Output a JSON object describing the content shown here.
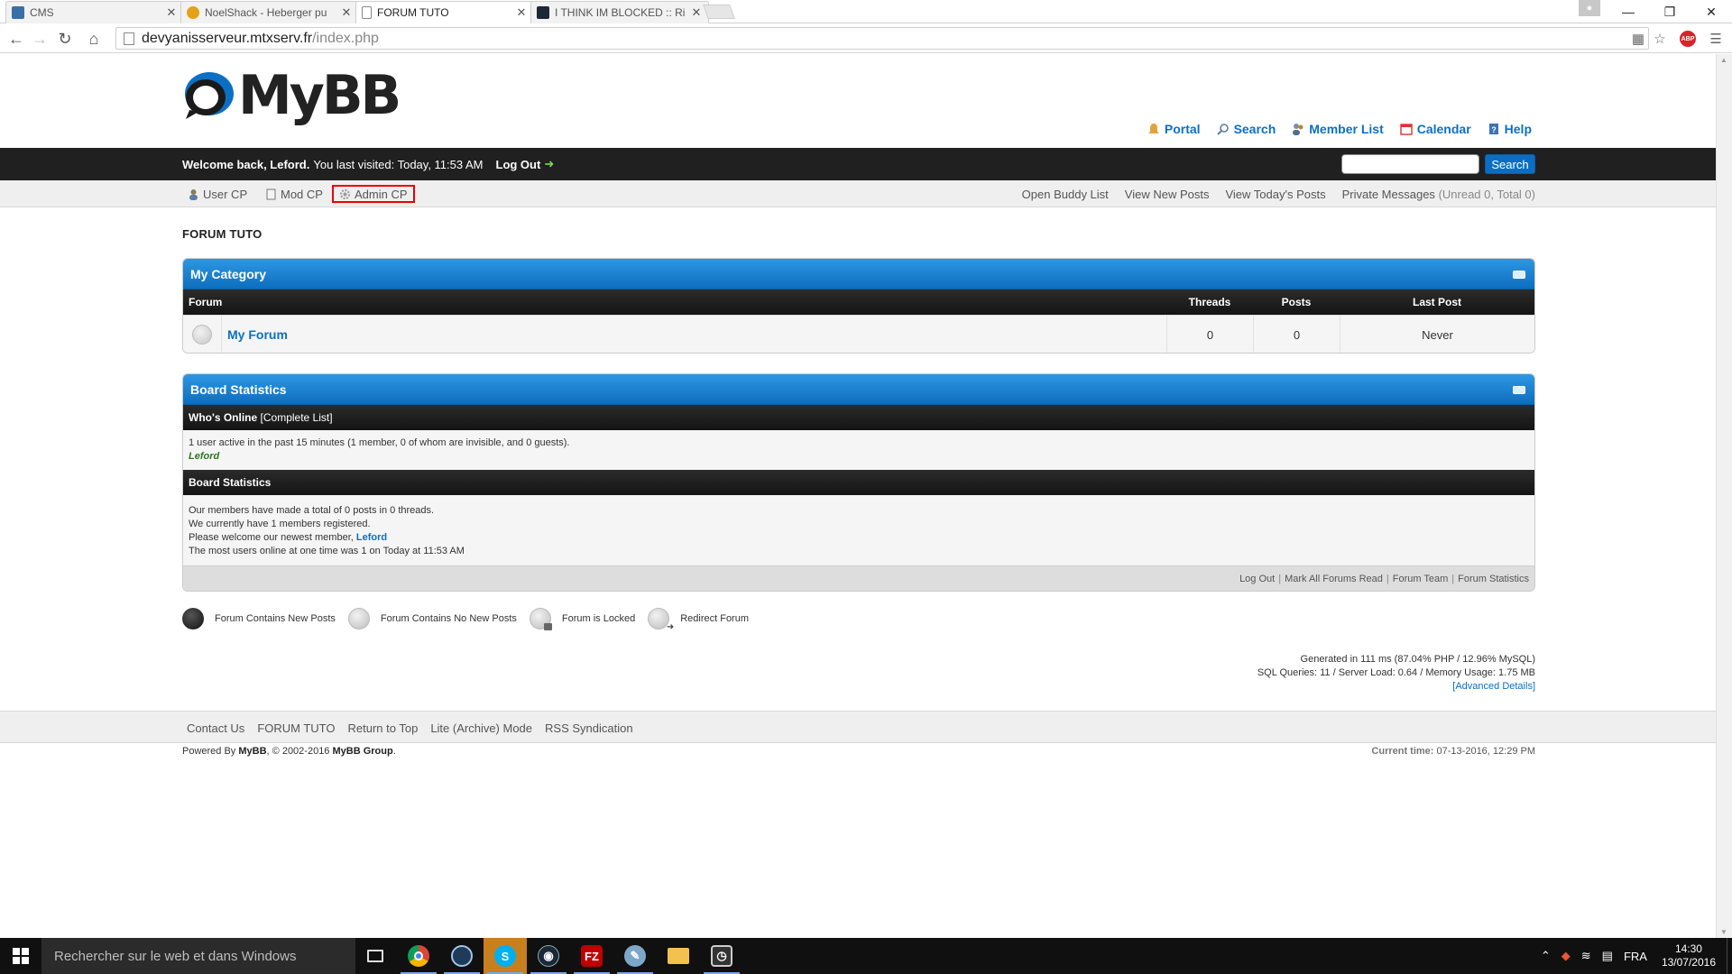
{
  "browser": {
    "tabs": [
      {
        "title": "CMS",
        "favicon_color": "#3b6ea5"
      },
      {
        "title": "NoelShack - Heberger pu",
        "favicon_color": "#e3a21a"
      },
      {
        "title": "FORUM TUTO",
        "favicon_color": "#ffffff"
      },
      {
        "title": "I THINK IM BLOCKED :: Ri",
        "favicon_color": "#1b2838"
      }
    ],
    "url_host": "devyanisserveur.mtxserv.fr",
    "url_path": "/index.php"
  },
  "site": {
    "logo_text": "MyBB",
    "accent": "#0b70c4",
    "toplinks": [
      "Portal",
      "Search",
      "Member List",
      "Calendar",
      "Help"
    ],
    "welcome": {
      "prefix": "Welcome back, Leford.",
      "last_visit": "You last visited: Today, 11:53 AM",
      "logout": "Log Out"
    },
    "search_button": "Search",
    "panel_left": [
      "User CP",
      "Mod CP",
      "Admin CP"
    ],
    "panel_right": [
      "Open Buddy List",
      "View New Posts",
      "View Today's Posts"
    ],
    "pm_label": "Private Messages",
    "pm_counts": "(Unread 0, Total 0)",
    "breadcrumb": "FORUM TUTO"
  },
  "category": {
    "title": "My Category",
    "columns": {
      "forum": "Forum",
      "threads": "Threads",
      "posts": "Posts",
      "lastpost": "Last Post"
    },
    "forums": [
      {
        "name": "My Forum",
        "threads": "0",
        "posts": "0",
        "lastpost": "Never"
      }
    ]
  },
  "stats": {
    "title": "Board Statistics",
    "online_header": "Who's Online",
    "online_link": "[Complete List]",
    "online_text": "1 user active in the past 15 minutes (1 member, 0 of whom are invisible, and 0 guests).",
    "online_user": "Leford",
    "board_header": "Board Statistics",
    "line1": "Our members have made a total of 0 posts in 0 threads.",
    "line2": "We currently have 1 members registered.",
    "line3_prefix": "Please welcome our newest member,",
    "newest_member": "Leford",
    "line4": "The most users online at one time was 1 on Today at 11:53 AM",
    "footer_links": [
      "Log Out",
      "Mark All Forums Read",
      "Forum Team",
      "Forum Statistics"
    ]
  },
  "legend": [
    "Forum Contains New Posts",
    "Forum Contains No New Posts",
    "Forum is Locked",
    "Redirect Forum"
  ],
  "debug": {
    "line1": "Generated in 111 ms (87.04% PHP / 12.96% MySQL)",
    "line2": "SQL Queries: 11 / Server Load: 0.64 / Memory Usage: 1.75 MB",
    "advanced": "[Advanced Details]"
  },
  "footer": {
    "links": [
      "Contact Us",
      "FORUM TUTO",
      "Return to Top",
      "Lite (Archive) Mode",
      "RSS Syndication"
    ],
    "powered_prefix": "Powered By",
    "powered_mybb": "MyBB",
    "powered_mid": ", © 2002-2016",
    "powered_group": "MyBB Group",
    "powered_end": ".",
    "current_time_label": "Current time:",
    "current_time_value": "07-13-2016, 12:29 PM"
  },
  "taskbar": {
    "search_placeholder": "Rechercher sur le web et dans Windows",
    "language": "FRA",
    "time": "14:30",
    "date": "13/07/2016"
  }
}
